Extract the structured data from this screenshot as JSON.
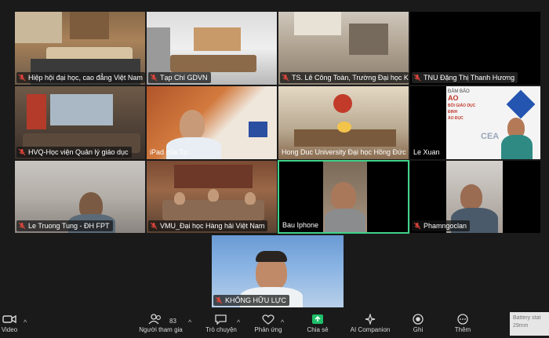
{
  "tiles": [
    {
      "name": "Hiệp hội đại học, cao đẳng Việt Nam"
    },
    {
      "name": "Tạp Chí GDVN"
    },
    {
      "name": "TS. Lê Công Toàn, Trường Đại học Kiế..."
    },
    {
      "name": "TNU Đặng Thị Thanh Hương"
    },
    {
      "name": "HVQ-Học viện Quản lý giáo dục"
    },
    {
      "name": "iPad của Tự"
    },
    {
      "name": "Hong Duc University Đại học Hồng Đức"
    },
    {
      "name": "Le Xuan"
    },
    {
      "name": "Le Truong Tung - ĐH FPT"
    },
    {
      "name": "VMU_Đại học Hàng hải Việt Nam"
    },
    {
      "name": "Bau Iphone"
    },
    {
      "name": "Phamngoclan"
    }
  ],
  "speaker": {
    "name": "KHỔNG HỮU LỰC"
  },
  "slide_text": {
    "line1": "AO",
    "line2": "BỒI GIÁO DỤC",
    "line3": "ĐỊNH",
    "line4": "ÀO ĐỤC",
    "logo": "CEA"
  },
  "toolbar": {
    "video_label": "Video",
    "participants_label": "Người tham gia",
    "participants_count": "83",
    "chat_label": "Trò chuyện",
    "reactions_label": "Phản ứng",
    "share_label": "Chia sẻ",
    "ai_label": "AI Companion",
    "record_label": "Ghi",
    "more_label": "Thêm"
  },
  "battery": {
    "line1": "Battery stat",
    "line2": "29mm"
  },
  "colors": {
    "active_border": "#3fd18a",
    "share_green": "#1fbf6a",
    "mic_red": "#e0463c"
  }
}
